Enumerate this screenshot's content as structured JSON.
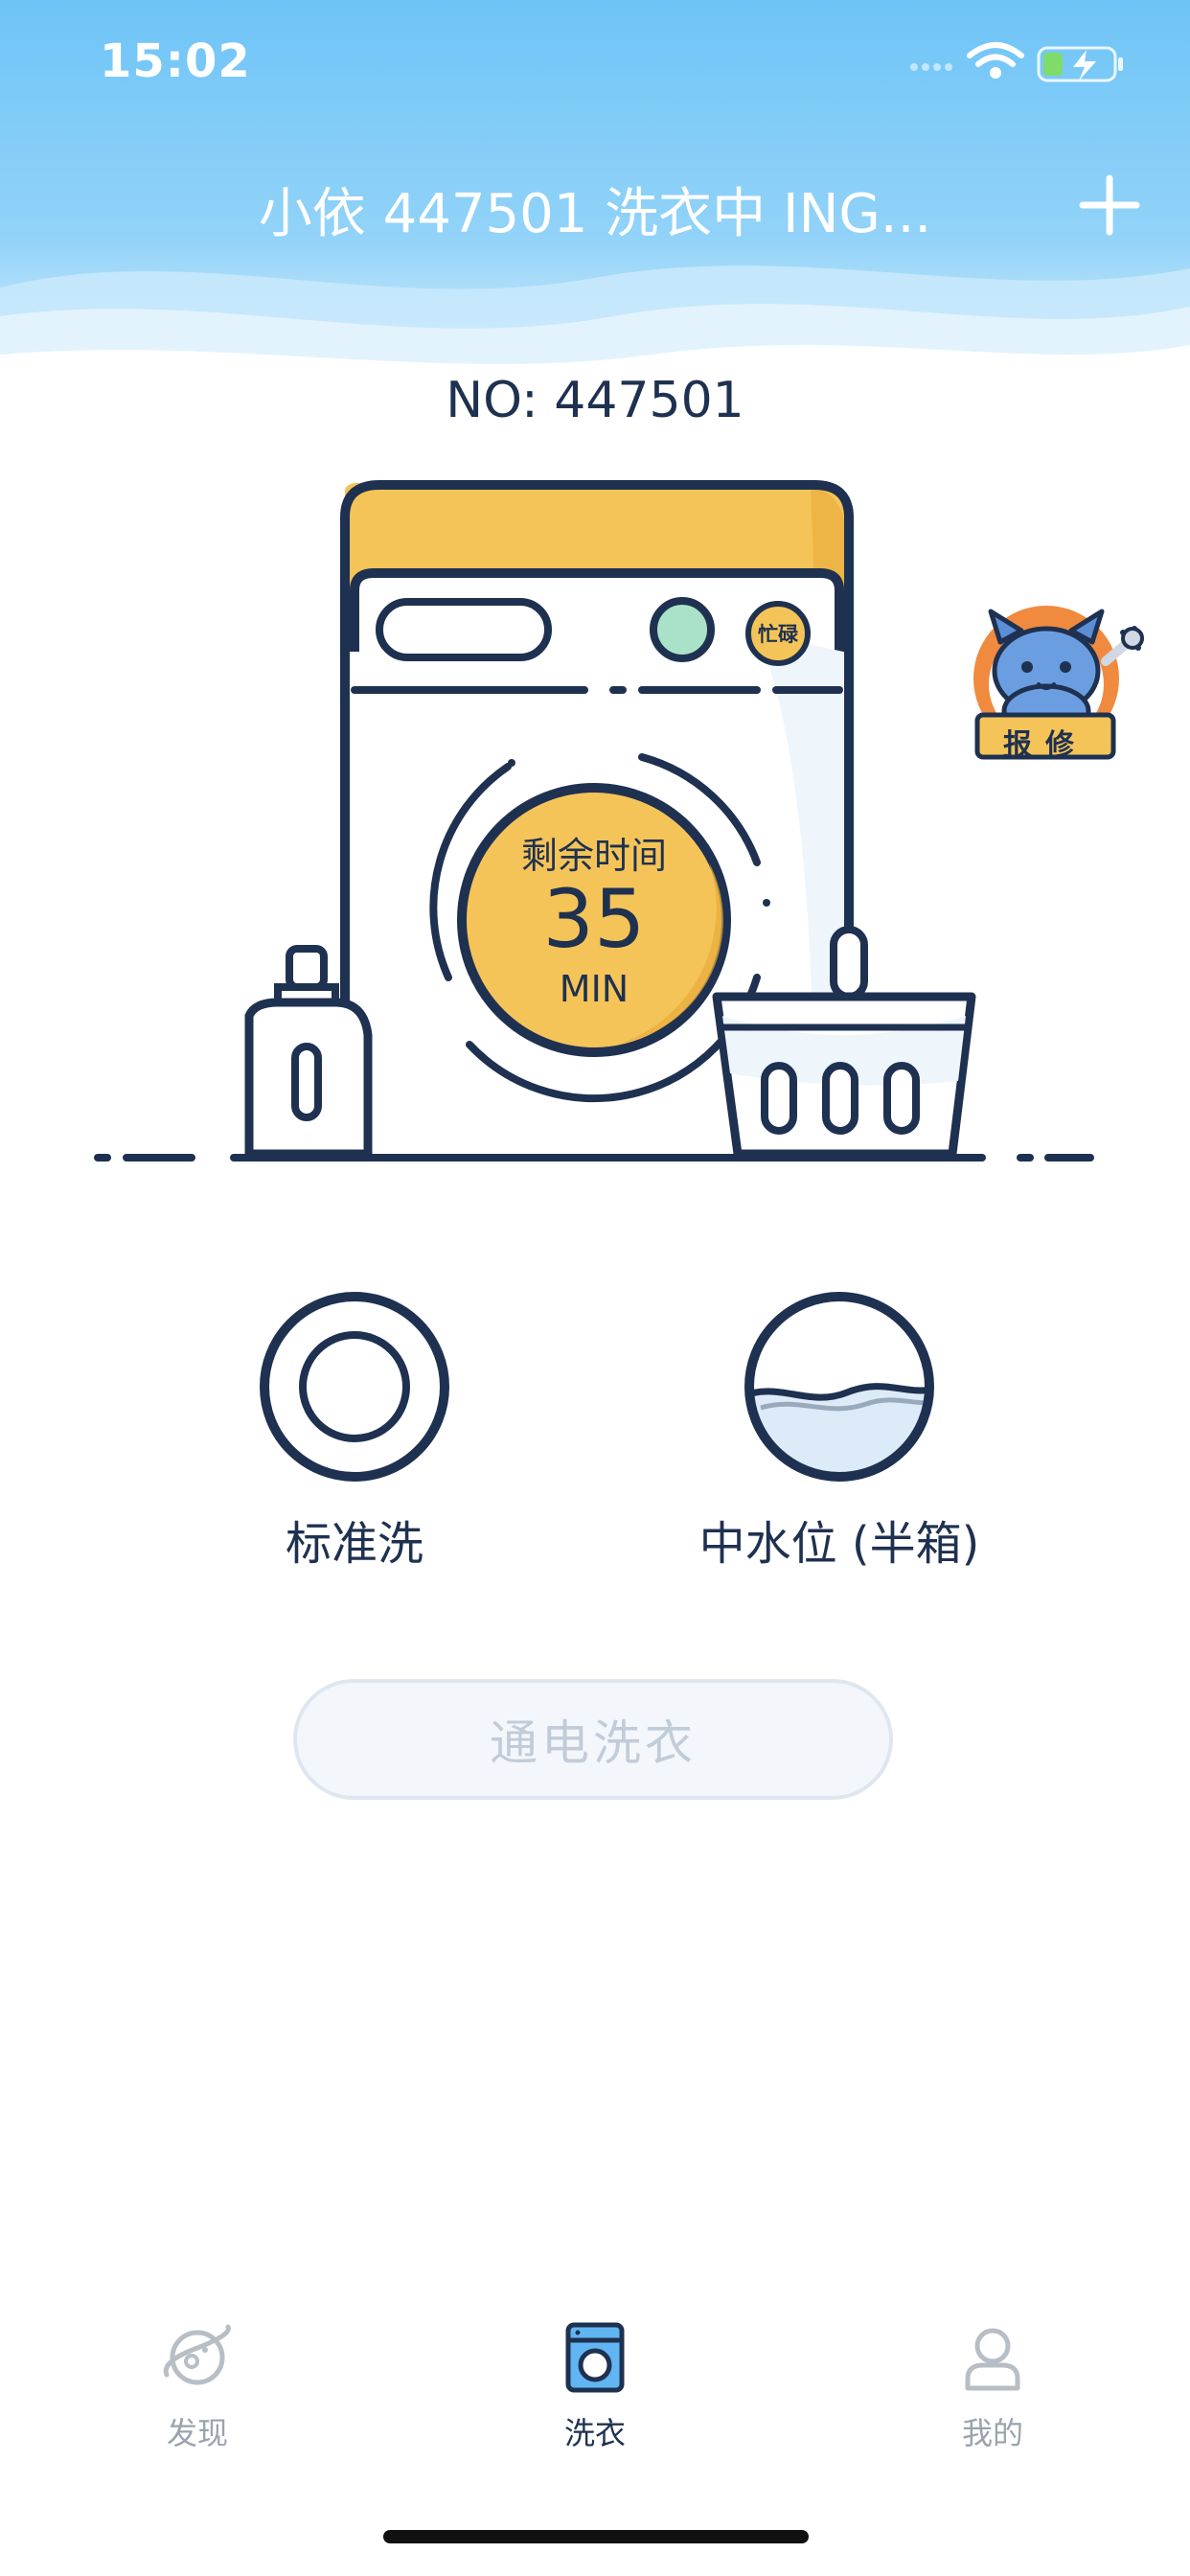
{
  "status_bar": {
    "time": "15:02"
  },
  "nav": {
    "title": "小依 447501 洗衣中 ING..."
  },
  "device": {
    "number_text": "NO: 447501"
  },
  "washer": {
    "remaining_label": "剩余时间",
    "remaining_value": "35",
    "remaining_unit": "MIN",
    "busy_label": "忙碌"
  },
  "repair": {
    "label": "报修"
  },
  "modes": {
    "wash_mode_label": "标准洗",
    "water_level_label": "中水位 (半箱)"
  },
  "actions": {
    "start_label": "通电洗衣"
  },
  "tabs": [
    {
      "label": "发现",
      "icon": "planet-icon"
    },
    {
      "label": "洗衣",
      "icon": "washing-machine-icon"
    },
    {
      "label": "我的",
      "icon": "user-icon"
    }
  ],
  "colors": {
    "navy": "#1f3150",
    "yellow": "#f5c458",
    "sky_blue": "#6ec4f7",
    "mint": "#a9e2c9",
    "tab_inactive": "#9aa3ad",
    "active_tab_fill": "#61b5f2"
  }
}
